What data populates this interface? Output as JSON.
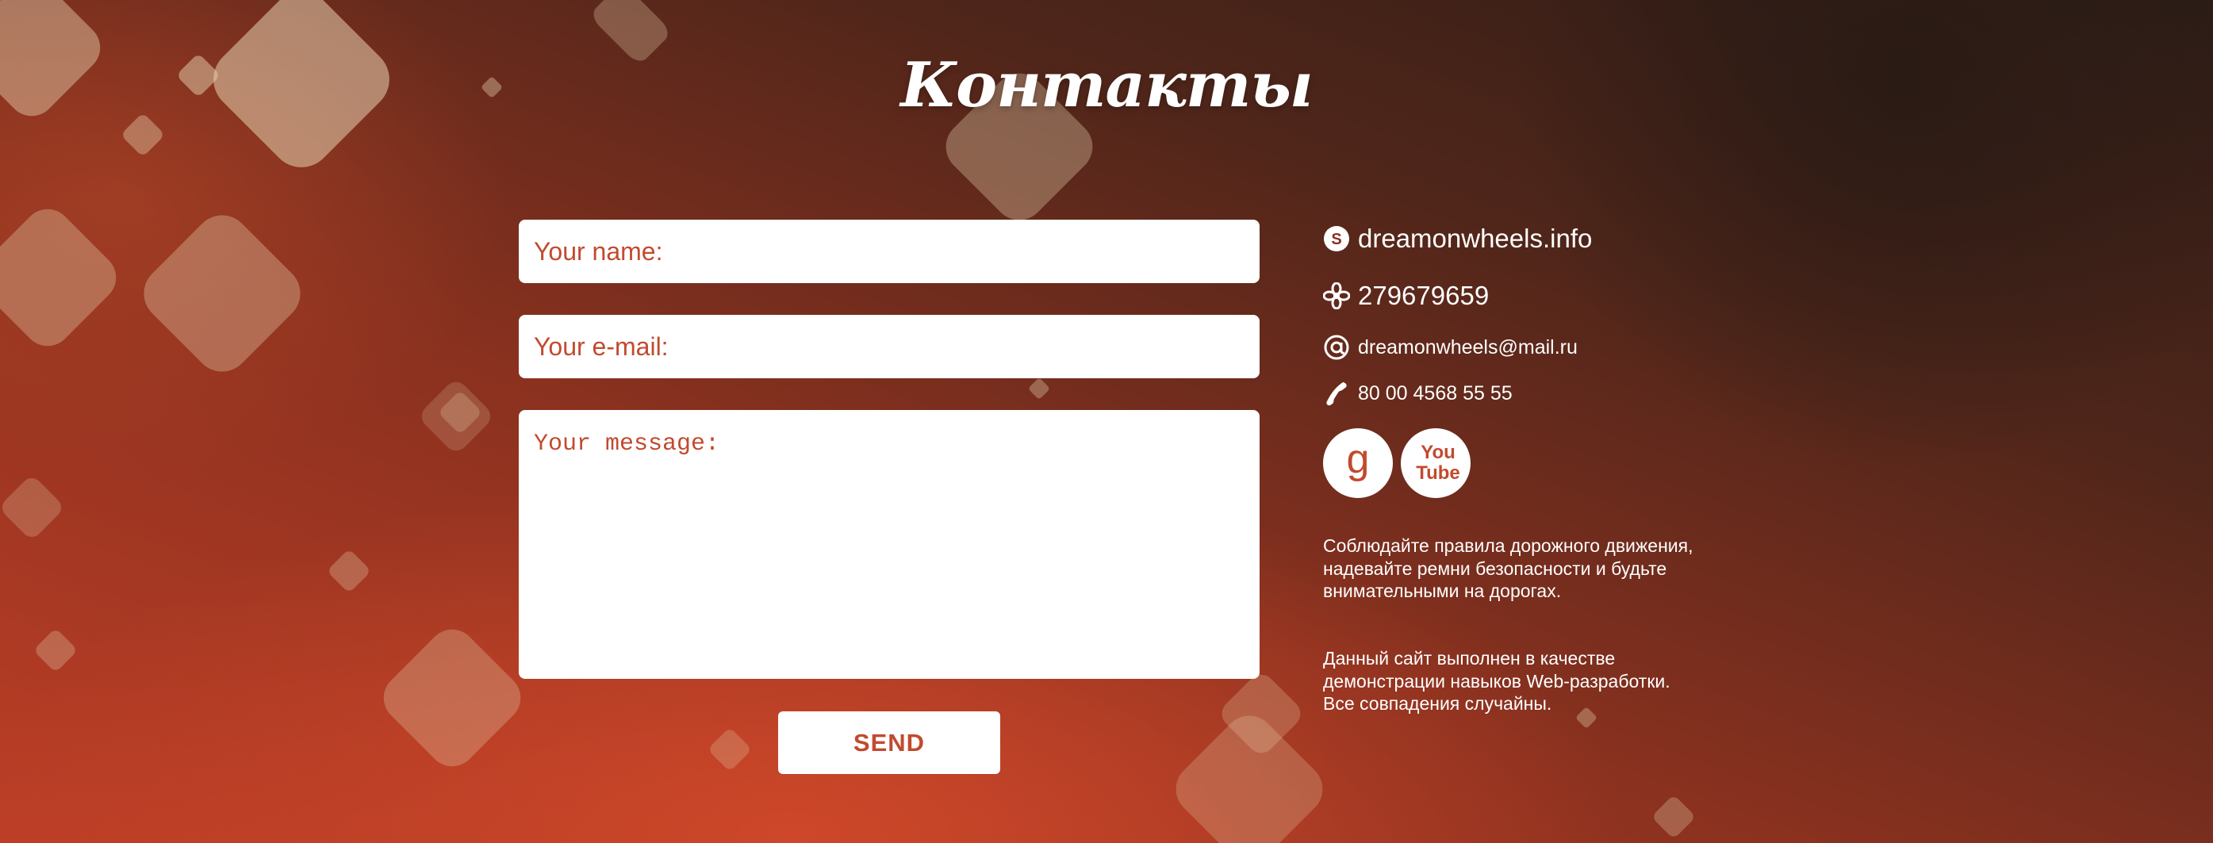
{
  "page": {
    "title": "Контакты"
  },
  "form": {
    "name_placeholder": "Your name:",
    "email_placeholder": "Your e-mail:",
    "message_placeholder": "Your message:",
    "send_label": "SEND"
  },
  "contacts": {
    "skype": {
      "icon": "skype-icon",
      "text": "dreamonwheels.info"
    },
    "icq": {
      "icon": "icq-flower-icon",
      "text": "279679659"
    },
    "email": {
      "icon": "at-sign-icon",
      "text": "dreamonwheels@mail.ru"
    },
    "phone": {
      "icon": "phone-icon",
      "text": "80 00 4568 55 55"
    }
  },
  "social": {
    "google": {
      "icon": "google-g-icon",
      "label": "g"
    },
    "youtube": {
      "icon": "youtube-logo-icon",
      "label": "You\nTube"
    }
  },
  "notes": {
    "safety": "Соблюдайте правила дорожного движения, надевайте ремни безопасности и будьте внимательными на дорогах.",
    "disclaimer": "Данный сайт выполнен в качестве демонстрации навыков Web-разработки. Все совпадения случайны."
  },
  "colors": {
    "accent": "#c24a2e",
    "field_bg": "#ffffff",
    "text_light": "#ffffff"
  }
}
